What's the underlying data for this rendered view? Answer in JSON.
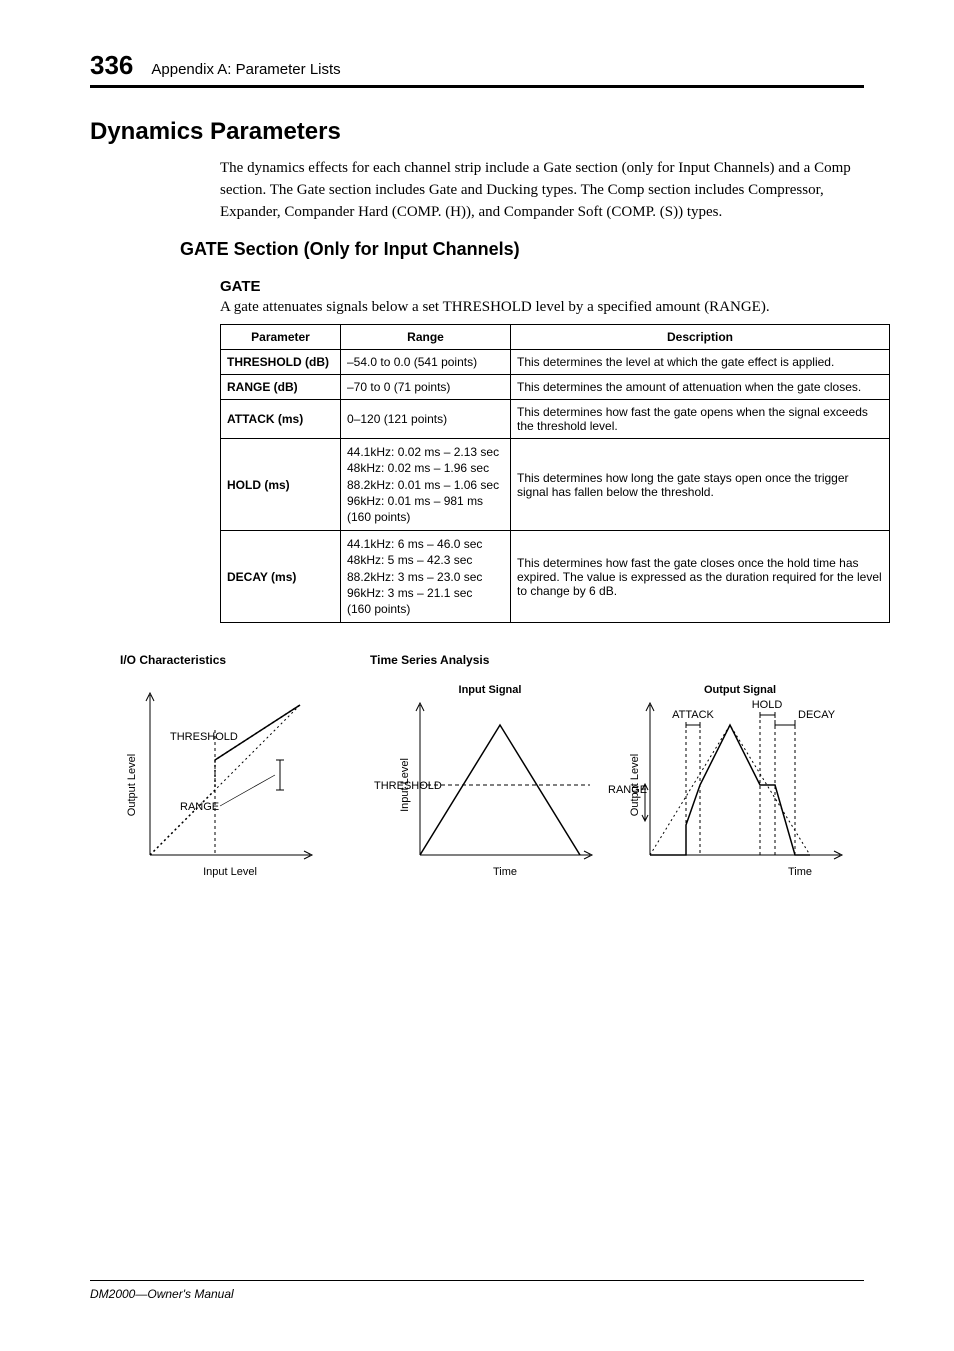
{
  "page_number": "336",
  "header": "Appendix A: Parameter Lists",
  "title": "Dynamics Parameters",
  "intro": "The dynamics effects for each channel strip include a Gate section (only for Input Channels) and a Comp section. The Gate section includes Gate and Ducking types. The Comp section includes Compressor, Expander, Compander Hard (COMP. (H)), and Compander Soft (COMP. (S)) types.",
  "subsection": "GATE Section (Only for Input Channels)",
  "gate_heading": "GATE",
  "gate_desc": "A gate attenuates signals below a set THRESHOLD level by a specified amount (RANGE).",
  "table": {
    "headers": {
      "c1": "Parameter",
      "c2": "Range",
      "c3": "Description"
    },
    "rows": [
      {
        "p": "THRESHOLD (dB)",
        "r": "–54.0 to 0.0 (541 points)",
        "d": "This determines the level at which the gate effect is applied."
      },
      {
        "p": "RANGE (dB)",
        "r": "–70 to 0 (71 points)",
        "d": "This determines the amount of attenuation when the gate closes."
      },
      {
        "p": "ATTACK (ms)",
        "r": "0–120 (121 points)",
        "d": "This determines how fast the gate opens when the signal exceeds the threshold level."
      },
      {
        "p": "HOLD (ms)",
        "r": "44.1kHz: 0.02 ms – 2.13 sec\n48kHz: 0.02 ms – 1.96 sec\n88.2kHz: 0.01 ms – 1.06 sec\n96kHz: 0.01 ms – 981 ms\n(160 points)",
        "d": "This determines how long the gate stays open once the trigger signal has fallen below the threshold."
      },
      {
        "p": "DECAY (ms)",
        "r": "44.1kHz: 6 ms – 46.0 sec\n48kHz: 5 ms – 42.3 sec\n88.2kHz: 3 ms – 23.0 sec\n96kHz: 3 ms – 21.1 sec\n(160 points)",
        "d": "This determines how fast the gate closes once the hold time has expired. The value is expressed as the duration required for the level to change by 6 dB."
      }
    ]
  },
  "chart_labels": {
    "io_title": "I/O Characteristics",
    "ts_title": "Time Series Analysis",
    "output_level": "Output Level",
    "input_level": "Input Level",
    "threshold": "THRESHOLD",
    "range": "RANGE",
    "input_signal": "Input Signal",
    "output_signal": "Output Signal",
    "time": "Time",
    "attack": "ATTACK",
    "hold": "HOLD",
    "decay": "DECAY"
  },
  "footer": "DM2000—Owner's Manual",
  "chart_data": [
    {
      "type": "line",
      "title": "I/O Characteristics",
      "xlabel": "Input Level",
      "ylabel": "Output Level",
      "annotations": [
        "THRESHOLD",
        "RANGE"
      ],
      "description": "Gate transfer curve: below threshold, output reduced by RANGE; above threshold, unity gain (dotted line)."
    },
    {
      "type": "line",
      "title": "Input Signal",
      "xlabel": "Time",
      "ylabel": "Input Level",
      "annotations": [
        "THRESHOLD"
      ],
      "description": "Triangular input envelope crossing threshold."
    },
    {
      "type": "line",
      "title": "Output Signal",
      "xlabel": "Time",
      "ylabel": "Output Level",
      "annotations": [
        "ATTACK",
        "HOLD",
        "DECAY",
        "RANGE"
      ],
      "description": "Gated output envelope showing attack, hold, and decay phases; attenuation by RANGE when closed."
    }
  ]
}
